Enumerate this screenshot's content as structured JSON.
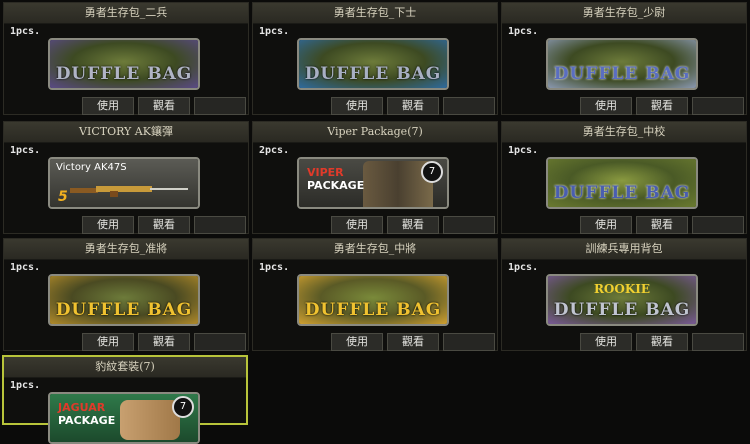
{
  "colors": {
    "accent_selected": "#b8c43a",
    "bag_text_blue": "#6a86c8",
    "bag_text_gold": "#f0c230"
  },
  "items": [
    {
      "title": "勇者生存包_二兵",
      "qty": "1pcs.",
      "thumb": "duffle",
      "thumb_text": "DUFFLE BAG",
      "tint": "#7a65a8",
      "text_color": "#9aa6c8",
      "icon": "duffle-bag-icon",
      "use": "使用",
      "view": "觀看"
    },
    {
      "title": "勇者生存包_下士",
      "qty": "1pcs.",
      "thumb": "duffle",
      "thumb_text": "DUFFLE BAG",
      "tint": "#3a7ab4",
      "text_color": "#9aa6c8",
      "icon": "duffle-bag-icon",
      "use": "使用",
      "view": "觀看"
    },
    {
      "title": "勇者生存包_少尉",
      "qty": "1pcs.",
      "thumb": "duffle",
      "thumb_text": "DUFFLE BAG",
      "tint": "#9aa8bc",
      "text_color": "#5a6ec0",
      "icon": "duffle-bag-icon",
      "use": "使用",
      "view": "觀看"
    },
    {
      "title": "VICTORY AK鑲彈",
      "qty": "1pcs.",
      "thumb": "victory",
      "thumb_text": "Victory AK47S",
      "num": "5",
      "icon": "rifle-icon",
      "use": "使用",
      "view": "觀看"
    },
    {
      "title": "Viper Package(7)",
      "qty": "2pcs.",
      "thumb": "viper",
      "thumb_text1": "VIPER",
      "thumb_text2": "PACKAGE",
      "num": "7",
      "icon": "soldier-package-icon",
      "use": "使用",
      "view": "觀看"
    },
    {
      "title": "勇者生存包_中校",
      "qty": "1pcs.",
      "thumb": "duffle",
      "thumb_text": "DUFFLE BAG",
      "tint": "#7a8a3a",
      "text_color": "#5a6ec0",
      "icon": "duffle-bag-icon",
      "use": "使用",
      "view": "觀看"
    },
    {
      "title": "勇者生存包_准將",
      "qty": "1pcs.",
      "thumb": "duffle",
      "thumb_text": "DUFFLE BAG",
      "tint": "#c8a036",
      "text_color": "#f0c230",
      "icon": "duffle-bag-icon",
      "use": "使用",
      "view": "觀看"
    },
    {
      "title": "勇者生存包_中將",
      "qty": "1pcs.",
      "thumb": "duffle",
      "thumb_text": "DUFFLE BAG",
      "tint": "#d8b040",
      "text_color": "#f0c230",
      "icon": "duffle-bag-icon",
      "use": "使用",
      "view": "觀看"
    },
    {
      "title": "訓練兵專用背包",
      "qty": "1pcs.",
      "thumb": "rookie",
      "thumb_top": "ROOKIE",
      "thumb_text": "DUFFLE BAG",
      "tint": "#8a6aa8",
      "text_color": "#9aa6c8",
      "icon": "duffle-bag-icon",
      "use": "使用",
      "view": "觀看"
    },
    {
      "title": "豹紋套裝(7)",
      "qty": "1pcs.",
      "thumb": "jaguar",
      "thumb_text1": "JAGUAR",
      "thumb_text2": "PACKAGE",
      "num": "7",
      "icon": "jaguar-package-icon",
      "selected": true
    }
  ]
}
